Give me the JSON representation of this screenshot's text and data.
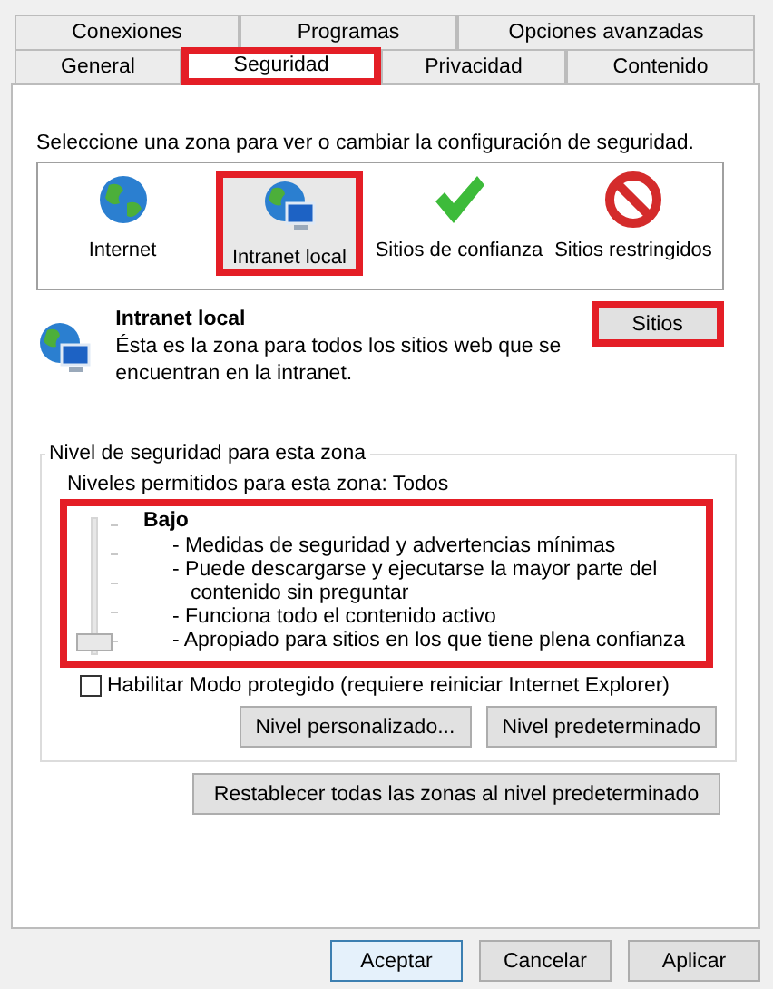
{
  "tabs_back": [
    {
      "label": "Conexiones",
      "selected": false
    },
    {
      "label": "Programas",
      "selected": false
    },
    {
      "label": "Opciones avanzadas",
      "selected": false
    }
  ],
  "tabs_front": [
    {
      "label": "General",
      "selected": false,
      "highlighted": false
    },
    {
      "label": "Seguridad",
      "selected": true,
      "highlighted": true
    },
    {
      "label": "Privacidad",
      "selected": false,
      "highlighted": false
    },
    {
      "label": "Contenido",
      "selected": false,
      "highlighted": false
    }
  ],
  "zone_prompt": "Seleccione una zona para ver o cambiar la configuración de seguridad.",
  "zones": [
    {
      "label": "Internet",
      "kind": "globe",
      "selected": false,
      "highlighted": false
    },
    {
      "label": "Intranet local",
      "kind": "intranet",
      "selected": true,
      "highlighted": true
    },
    {
      "label": "Sitios de confianza",
      "kind": "check",
      "selected": false,
      "highlighted": false
    },
    {
      "label": "Sitios restringidos",
      "kind": "blocked",
      "selected": false,
      "highlighted": false
    }
  ],
  "zone_info": {
    "title": "Intranet local",
    "description": "Ésta es la zona para todos los sitios web que se encuentran en la intranet.",
    "sites_button": "Sitios",
    "sites_button_highlighted": true
  },
  "security_level": {
    "group_title": "Nivel de seguridad para esta zona",
    "allowed_levels": "Niveles permitidos para esta zona: Todos",
    "highlighted": true,
    "level": 0,
    "level_name": "Bajo",
    "details": [
      "- Medidas de seguridad y advertencias mínimas",
      "- Puede descargarse y ejecutarse la mayor parte del contenido sin preguntar",
      "- Funciona todo el contenido activo",
      "- Apropiado para sitios en los que tiene plena confianza"
    ],
    "protected_mode": {
      "label": "Habilitar Modo protegido (requiere reiniciar Internet Explorer)",
      "checked": false
    },
    "buttons": [
      "Nivel personalizado...",
      "Nivel predeterminado"
    ]
  },
  "reset_button": "Restablecer todas las zonas al nivel predeterminado",
  "dialog_buttons": [
    {
      "label": "Aceptar",
      "default": true
    },
    {
      "label": "Cancelar",
      "default": false
    },
    {
      "label": "Aplicar",
      "default": false
    }
  ]
}
